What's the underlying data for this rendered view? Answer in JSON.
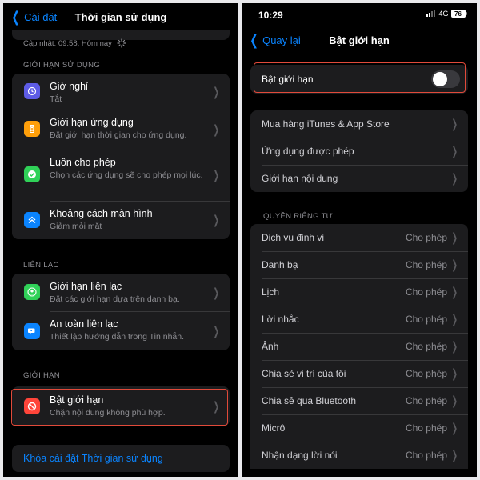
{
  "left": {
    "back_label": "Cài đặt",
    "title": "Thời gian sử dụng",
    "update_text": "Cập nhật: 09:58, Hôm nay",
    "section_limits": "GIỚI HẠN SỬ DỤNG",
    "usage_items": [
      {
        "title": "Giờ nghỉ",
        "subtitle": "Tắt",
        "icon": "moon-clock-icon",
        "color": "#5e5ce6"
      },
      {
        "title": "Giới hạn ứng dụng",
        "subtitle": "Đặt giới hạn thời gian cho ứng dụng.",
        "icon": "hourglass-icon",
        "color": "#ff9f0a"
      },
      {
        "title": "Luôn cho phép",
        "subtitle": "Chọn các ứng dụng sẽ cho phép mọi lúc.",
        "icon": "checkmark-icon",
        "color": "#30d158"
      },
      {
        "title": "Khoảng cách màn hình",
        "subtitle": "Giảm mỏi mắt",
        "icon": "chevrons-up-icon",
        "color": "#0a84ff"
      }
    ],
    "section_contact": "LIÊN LẠC",
    "contact_items": [
      {
        "title": "Giới hạn liên lạc",
        "subtitle": "Đặt các giới hạn dựa trên danh bạ.",
        "icon": "person-circle-icon",
        "color": "#30d158"
      },
      {
        "title": "An toàn liên lạc",
        "subtitle": "Thiết lập hướng dẫn trong Tin nhắn.",
        "icon": "message-bubble-icon",
        "color": "#0a84ff"
      }
    ],
    "section_restrict": "GIỚI HẠN",
    "restrict_item": {
      "title": "Bật giới hạn",
      "subtitle": "Chặn nội dung không phù hợp.",
      "icon": "block-icon",
      "color": "#ff453a"
    },
    "lock_link": "Khóa cài đặt Thời gian sử dụng"
  },
  "right": {
    "time": "10:29",
    "network": "4G",
    "battery": "76",
    "back_label": "Quay lại",
    "title": "Bật giới hạn",
    "toggle_label": "Bật giới hạn",
    "toggle_on": false,
    "menu_items": [
      "Mua hàng iTunes & App Store",
      "Ứng dụng được phép",
      "Giới hạn nội dung"
    ],
    "section_privacy": "QUYỀN RIÊNG TƯ",
    "privacy_items": [
      {
        "label": "Dịch vụ định vị",
        "value": "Cho phép"
      },
      {
        "label": "Danh bạ",
        "value": "Cho phép"
      },
      {
        "label": "Lịch",
        "value": "Cho phép"
      },
      {
        "label": "Lời nhắc",
        "value": "Cho phép"
      },
      {
        "label": "Ảnh",
        "value": "Cho phép"
      },
      {
        "label": "Chia sẻ vị trí của tôi",
        "value": "Cho phép"
      },
      {
        "label": "Chia sẻ qua Bluetooth",
        "value": "Cho phép"
      },
      {
        "label": "Micrô",
        "value": "Cho phép"
      },
      {
        "label": "Nhận dạng lời nói",
        "value": "Cho phép"
      }
    ]
  },
  "colors": {
    "accent": "#0a84ff",
    "highlight": "#e14a3a",
    "cell": "#1c1c1e"
  }
}
